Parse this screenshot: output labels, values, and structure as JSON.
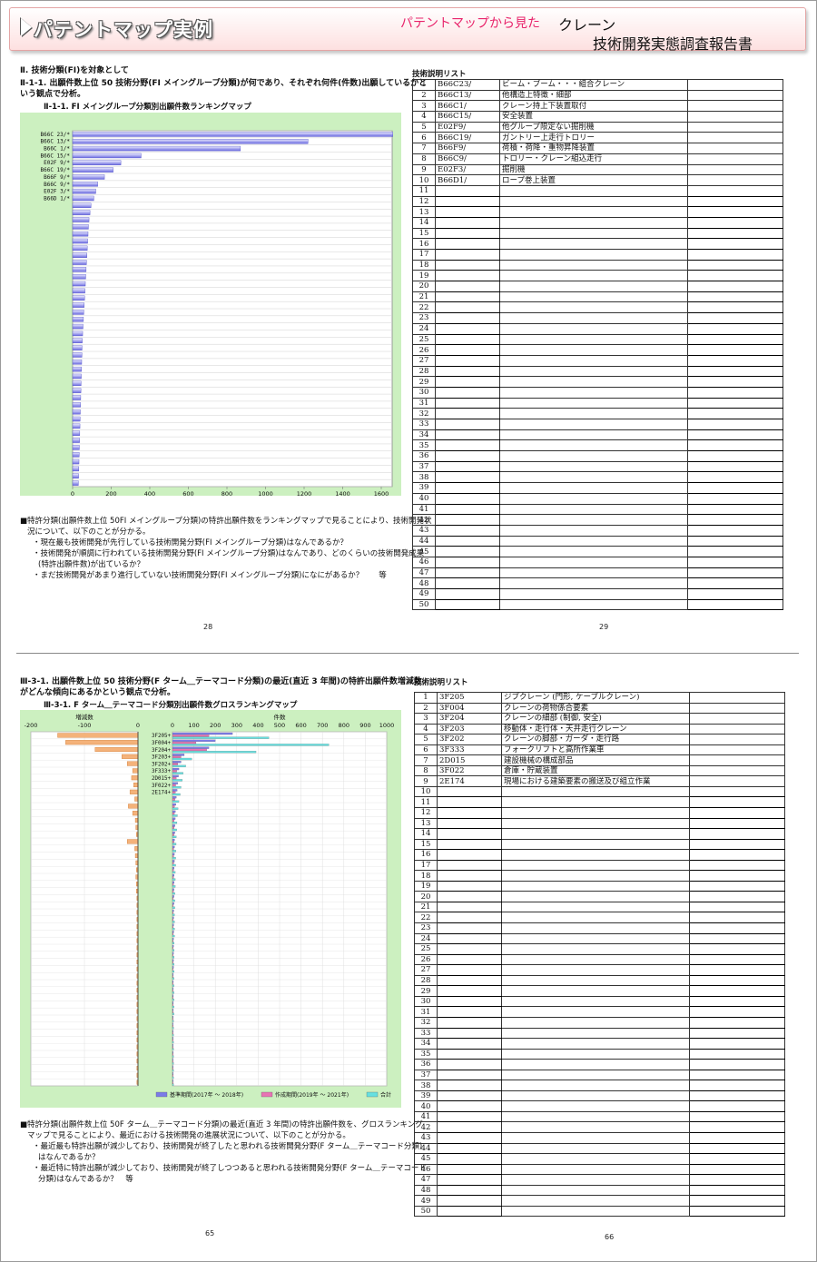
{
  "header": {
    "brand": "パテントマップ実例",
    "subtitle": "パテントマップから見た",
    "subject": "クレーン",
    "title": "技術開発実態調査報告書"
  },
  "page1": {
    "section": "Ⅱ. 技術分類(FI)を対象として",
    "heading1": "Ⅱ-1-1. 出願件数上位 50 技術分野(FI メイングループ分類)が何であり、それぞれ何件(件数)出願しているかと",
    "heading2": "いう観点で分析。",
    "chart_title": "Ⅱ-1-1. FI メイングループ分類別出願件数ランキングマップ",
    "notes": [
      "■特許分類(出願件数上位 50FI メイングループ分類)の特許出願件数をランキングマップで見ることにより、技術開発状",
      "況について、以下のことが分かる。",
      "・現在最も技術開発が先行している技術開発分野(FI メイングループ分類)はなんであるか？",
      "・技術開発が順調に行われている技術開発分野(FI メイングループ分類)はなんであり、どのくらいの技術開発成果",
      "(特許出願件数)が出ているか？",
      "・まだ技術開発があまり進行していない技術開発分野(FI メイングループ分類)になにがあるか？　　等"
    ],
    "page_number": "28"
  },
  "page2": {
    "list_title": "技術説明リスト",
    "rows": [
      {
        "no": "1",
        "code": "B66C23/",
        "desc": "ビーム・ブーム・・・組合クレーン"
      },
      {
        "no": "2",
        "code": "B66C13/",
        "desc": "他構造上特徴・細部"
      },
      {
        "no": "3",
        "code": "B66C1/",
        "desc": "クレーン持上下装置取付"
      },
      {
        "no": "4",
        "code": "B66C15/",
        "desc": "安全装置"
      },
      {
        "no": "5",
        "code": "E02F9/",
        "desc": "他グループ限定ない掘削機"
      },
      {
        "no": "6",
        "code": "B66C19/",
        "desc": "ガントリー上走行トロリー"
      },
      {
        "no": "7",
        "code": "B66F9/",
        "desc": "荷積・荷降・重物昇降装置"
      },
      {
        "no": "8",
        "code": "B66C9/",
        "desc": "トロリー・クレーン組込走行"
      },
      {
        "no": "9",
        "code": "E02F3/",
        "desc": "掘削機"
      },
      {
        "no": "10",
        "code": "B66D1/",
        "desc": "ロープ巻上装置"
      }
    ],
    "total_rows": 50,
    "page_number": "29"
  },
  "page3": {
    "heading1": "Ⅲ-3-1. 出願件数上位 50 技術分野(F ターム＿テーマコード分類)の最近(直近 3 年間)の特許出願件数増減数",
    "heading2": "がどんな傾向にあるかという観点で分析。",
    "chart_title": "Ⅲ-3-1. F ターム＿テーマコード分類別出願件数グロスランキングマップ",
    "notes": [
      "■特許分類(出願件数上位 50F ターム＿テーマコード分類)の最近(直近 3 年間)の特許出願件数を、グロスランキング",
      "マップで見ることにより、最近における技術開発の進展状況について、以下のことが分かる。",
      "・最近最も特許出願が減少しており、技術開発が終了したと思われる技術開発分野(F ターム＿テーマコード分類)",
      "はなんであるか？",
      "・最近特に特許出願が減少しており、技術開発が終了しつつあると思われる技術開発分野(F ターム＿テーマコード",
      "分類)はなんであるか？　等"
    ],
    "page_number": "65"
  },
  "page4": {
    "list_title": "技術説明リスト",
    "rows": [
      {
        "no": "1",
        "code": "3F205",
        "desc": "ジブクレーン (門形, ケーブルクレーン)"
      },
      {
        "no": "2",
        "code": "3F004",
        "desc": "クレーンの荷物係合要素"
      },
      {
        "no": "3",
        "code": "3F204",
        "desc": "クレーンの細部 (制御, 安全)"
      },
      {
        "no": "4",
        "code": "3F203",
        "desc": "移動体・走行体・天井走行クレーン"
      },
      {
        "no": "5",
        "code": "3F202",
        "desc": "クレーンの脚部・ガーダ・走行路"
      },
      {
        "no": "6",
        "code": "3F333",
        "desc": "フォークリフトと高所作業車"
      },
      {
        "no": "7",
        "code": "2D015",
        "desc": "建設機械の構成部品"
      },
      {
        "no": "8",
        "code": "3F022",
        "desc": "倉庫・貯蔵装置"
      },
      {
        "no": "9",
        "code": "2E174",
        "desc": "現場における建築要素の搬送及び組立作業"
      }
    ],
    "total_rows": 50,
    "page_number": "66"
  },
  "chart_data": [
    {
      "type": "bar",
      "title": "Ⅱ-1-1. FI メイングループ分類別出願件数ランキングマップ",
      "orientation": "horizontal",
      "categories": [
        "B66C 23/*",
        "B66C 13/*",
        "B66C 1/*",
        "B66C 15/*",
        "E02F 9/*",
        "B66C 19/*",
        "B66F 9/*",
        "B66C 9/*",
        "E02F 3/*",
        "B66D 1/*"
      ],
      "values": [
        1660,
        1220,
        870,
        355,
        250,
        210,
        165,
        130,
        120,
        110,
        95,
        90,
        85,
        82,
        80,
        78,
        76,
        74,
        72,
        70,
        68,
        66,
        64,
        62,
        60,
        58,
        56,
        54,
        52,
        50,
        49,
        48,
        47,
        46,
        45,
        44,
        43,
        42,
        41,
        40,
        39,
        38,
        37,
        36,
        35,
        34,
        33,
        32,
        31,
        30
      ],
      "xlim": [
        0,
        1600
      ],
      "xticks": [
        "0",
        "200",
        "400",
        "600",
        "800",
        "1000",
        "1200",
        "1400",
        "1600"
      ],
      "xunit": "件",
      "grid": true
    },
    {
      "type": "bar",
      "title": "Ⅲ-3-1. F ターム＿テーマコード分類別出願件数グロスランキングマップ",
      "orientation": "horizontal",
      "categories": [
        "3F205+",
        "3F004+",
        "3F204+",
        "3F203+",
        "3F202+",
        "3F333+",
        "2D015+",
        "3F022+",
        "2E174+"
      ],
      "left_axis": {
        "label": "増減数",
        "xlim": [
          -200,
          0
        ],
        "xticks": [
          "-200",
          "-100",
          "0"
        ]
      },
      "right_axis": {
        "label": "件数",
        "xlim": [
          0,
          1000
        ],
        "xticks": [
          "0",
          "100",
          "200",
          "300",
          "400",
          "500",
          "600",
          "700",
          "800",
          "900",
          "1000"
        ]
      },
      "change": [
        -150,
        -135,
        -80,
        -30,
        -20,
        -10,
        -12,
        -8,
        -15,
        -6,
        -18,
        -10,
        -5,
        -4,
        -3,
        -20,
        -6,
        -5,
        -4,
        -3,
        -4,
        -3,
        -3,
        -2,
        -2,
        -2,
        -2,
        -2,
        -2,
        -2,
        -2,
        -2,
        -2,
        -2,
        -2,
        -2,
        -2,
        -2,
        -2,
        -2,
        -2,
        -2,
        -2,
        -2,
        -2,
        -2,
        -2,
        -2,
        -2,
        -2
      ],
      "series": [
        {
          "name": "基準期間(2017年 ～ 2018年)",
          "color": "#7b7be8",
          "values": [
            280,
            200,
            170,
            55,
            40,
            30,
            28,
            25,
            22,
            18,
            16,
            14,
            13,
            12,
            11,
            10,
            10,
            9,
            9,
            8,
            8,
            8,
            7,
            7,
            7,
            6,
            6,
            6,
            6,
            5,
            5,
            5,
            5,
            5,
            4,
            4,
            4,
            4,
            4,
            4,
            3,
            3,
            3,
            3,
            3,
            3,
            3,
            3,
            3,
            3
          ]
        },
        {
          "name": "作成期間(2019年 ～ 2021年)",
          "color": "#e874b4",
          "values": [
            170,
            110,
            160,
            40,
            25,
            20,
            18,
            15,
            14,
            12,
            10,
            9,
            8,
            8,
            7,
            7,
            6,
            6,
            6,
            5,
            5,
            5,
            5,
            4,
            4,
            4,
            4,
            4,
            4,
            3,
            3,
            3,
            3,
            3,
            3,
            3,
            3,
            3,
            3,
            3,
            2,
            2,
            2,
            2,
            2,
            2,
            2,
            2,
            2,
            2
          ]
        },
        {
          "name": "合計",
          "color": "#66e0e0",
          "values": [
            450,
            730,
            390,
            90,
            62,
            50,
            46,
            40,
            36,
            30,
            26,
            23,
            21,
            20,
            18,
            17,
            16,
            15,
            15,
            13,
            13,
            13,
            12,
            11,
            11,
            10,
            10,
            10,
            10,
            8,
            8,
            8,
            8,
            8,
            7,
            7,
            7,
            7,
            7,
            7,
            5,
            5,
            5,
            5,
            5,
            5,
            5,
            5,
            5,
            5
          ]
        }
      ],
      "legend_position": "bottom-right",
      "grid": true
    }
  ]
}
